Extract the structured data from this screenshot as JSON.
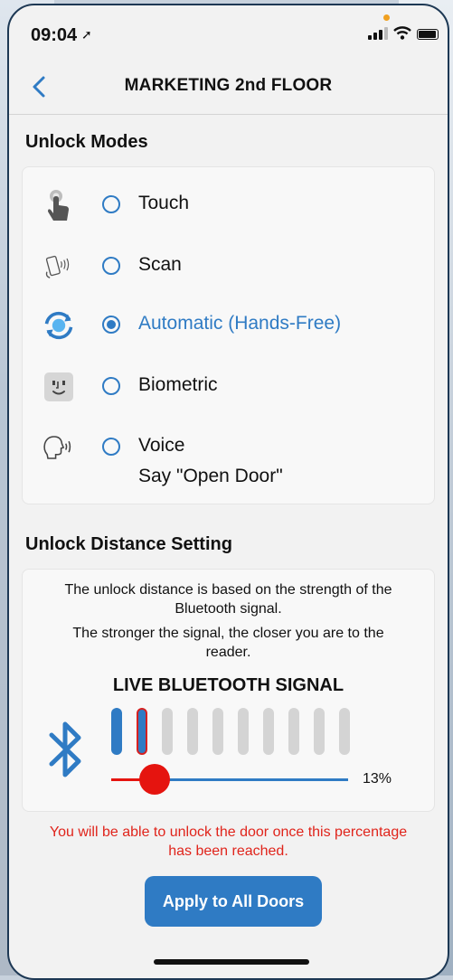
{
  "status_bar": {
    "time": "09:04",
    "location_glyph": "➚"
  },
  "nav": {
    "back_icon": "chevron-left",
    "title": "MARKETING 2nd FLOOR"
  },
  "unlock_modes": {
    "title": "Unlock Modes",
    "modes": [
      {
        "icon": "touch-hand-icon",
        "label": "Touch",
        "selected": false
      },
      {
        "icon": "phone-scan-icon",
        "label": "Scan",
        "selected": false
      },
      {
        "icon": "sync-arrows-icon",
        "label": "Automatic (Hands-Free)",
        "selected": true
      },
      {
        "icon": "face-id-icon",
        "label": "Biometric",
        "selected": false
      },
      {
        "icon": "speaking-head-icon",
        "label": "Voice",
        "selected": false,
        "sublabel": "Say \"Open Door\""
      }
    ]
  },
  "distance": {
    "title": "Unlock Distance Setting",
    "info_1": "The unlock distance is based on the strength of the Bluetooth signal.",
    "info_2": "The stronger the signal, the closer you are to the reader.",
    "live_title": "LIVE BLUETOOTH SIGNAL",
    "signal_bars_total": 10,
    "signal_bars_active": 2,
    "threshold_percent": 13,
    "percent_label": "13%",
    "warning": "You will be able to unlock the door once this percentage has been reached."
  },
  "apply_button": "Apply to All Doors",
  "colors": {
    "accent": "#2f7bc4",
    "alert": "#e0241b",
    "background": "#f2f2f2"
  }
}
